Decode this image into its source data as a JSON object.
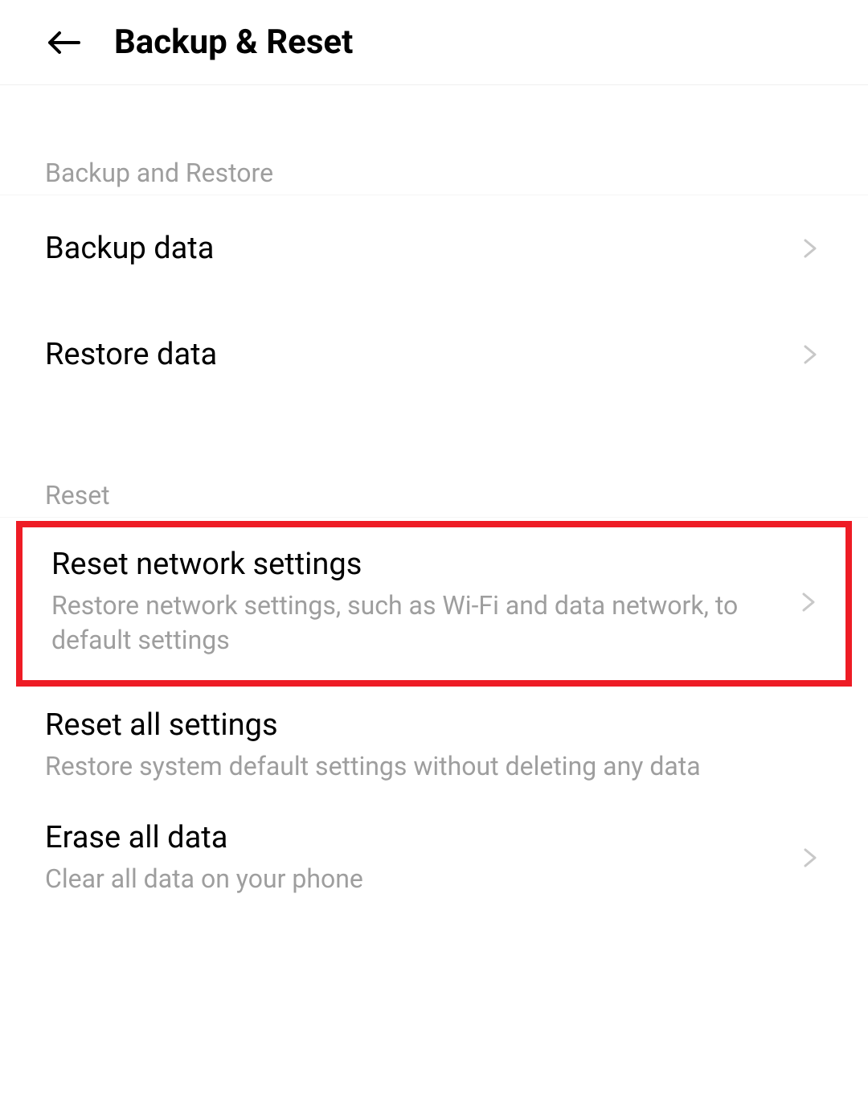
{
  "header": {
    "title": "Backup & Reset"
  },
  "sections": {
    "backup_restore": {
      "label": "Backup and Restore",
      "items": {
        "backup_data": {
          "title": "Backup data"
        },
        "restore_data": {
          "title": "Restore data"
        }
      }
    },
    "reset": {
      "label": "Reset",
      "items": {
        "reset_network": {
          "title": "Reset network settings",
          "subtitle": "Restore network settings, such as Wi-Fi and data network, to default settings"
        },
        "reset_all": {
          "title": "Reset all settings",
          "subtitle": "Restore system default settings without deleting any data"
        },
        "erase_all": {
          "title": "Erase all data",
          "subtitle": "Clear all data on your phone"
        }
      }
    }
  }
}
